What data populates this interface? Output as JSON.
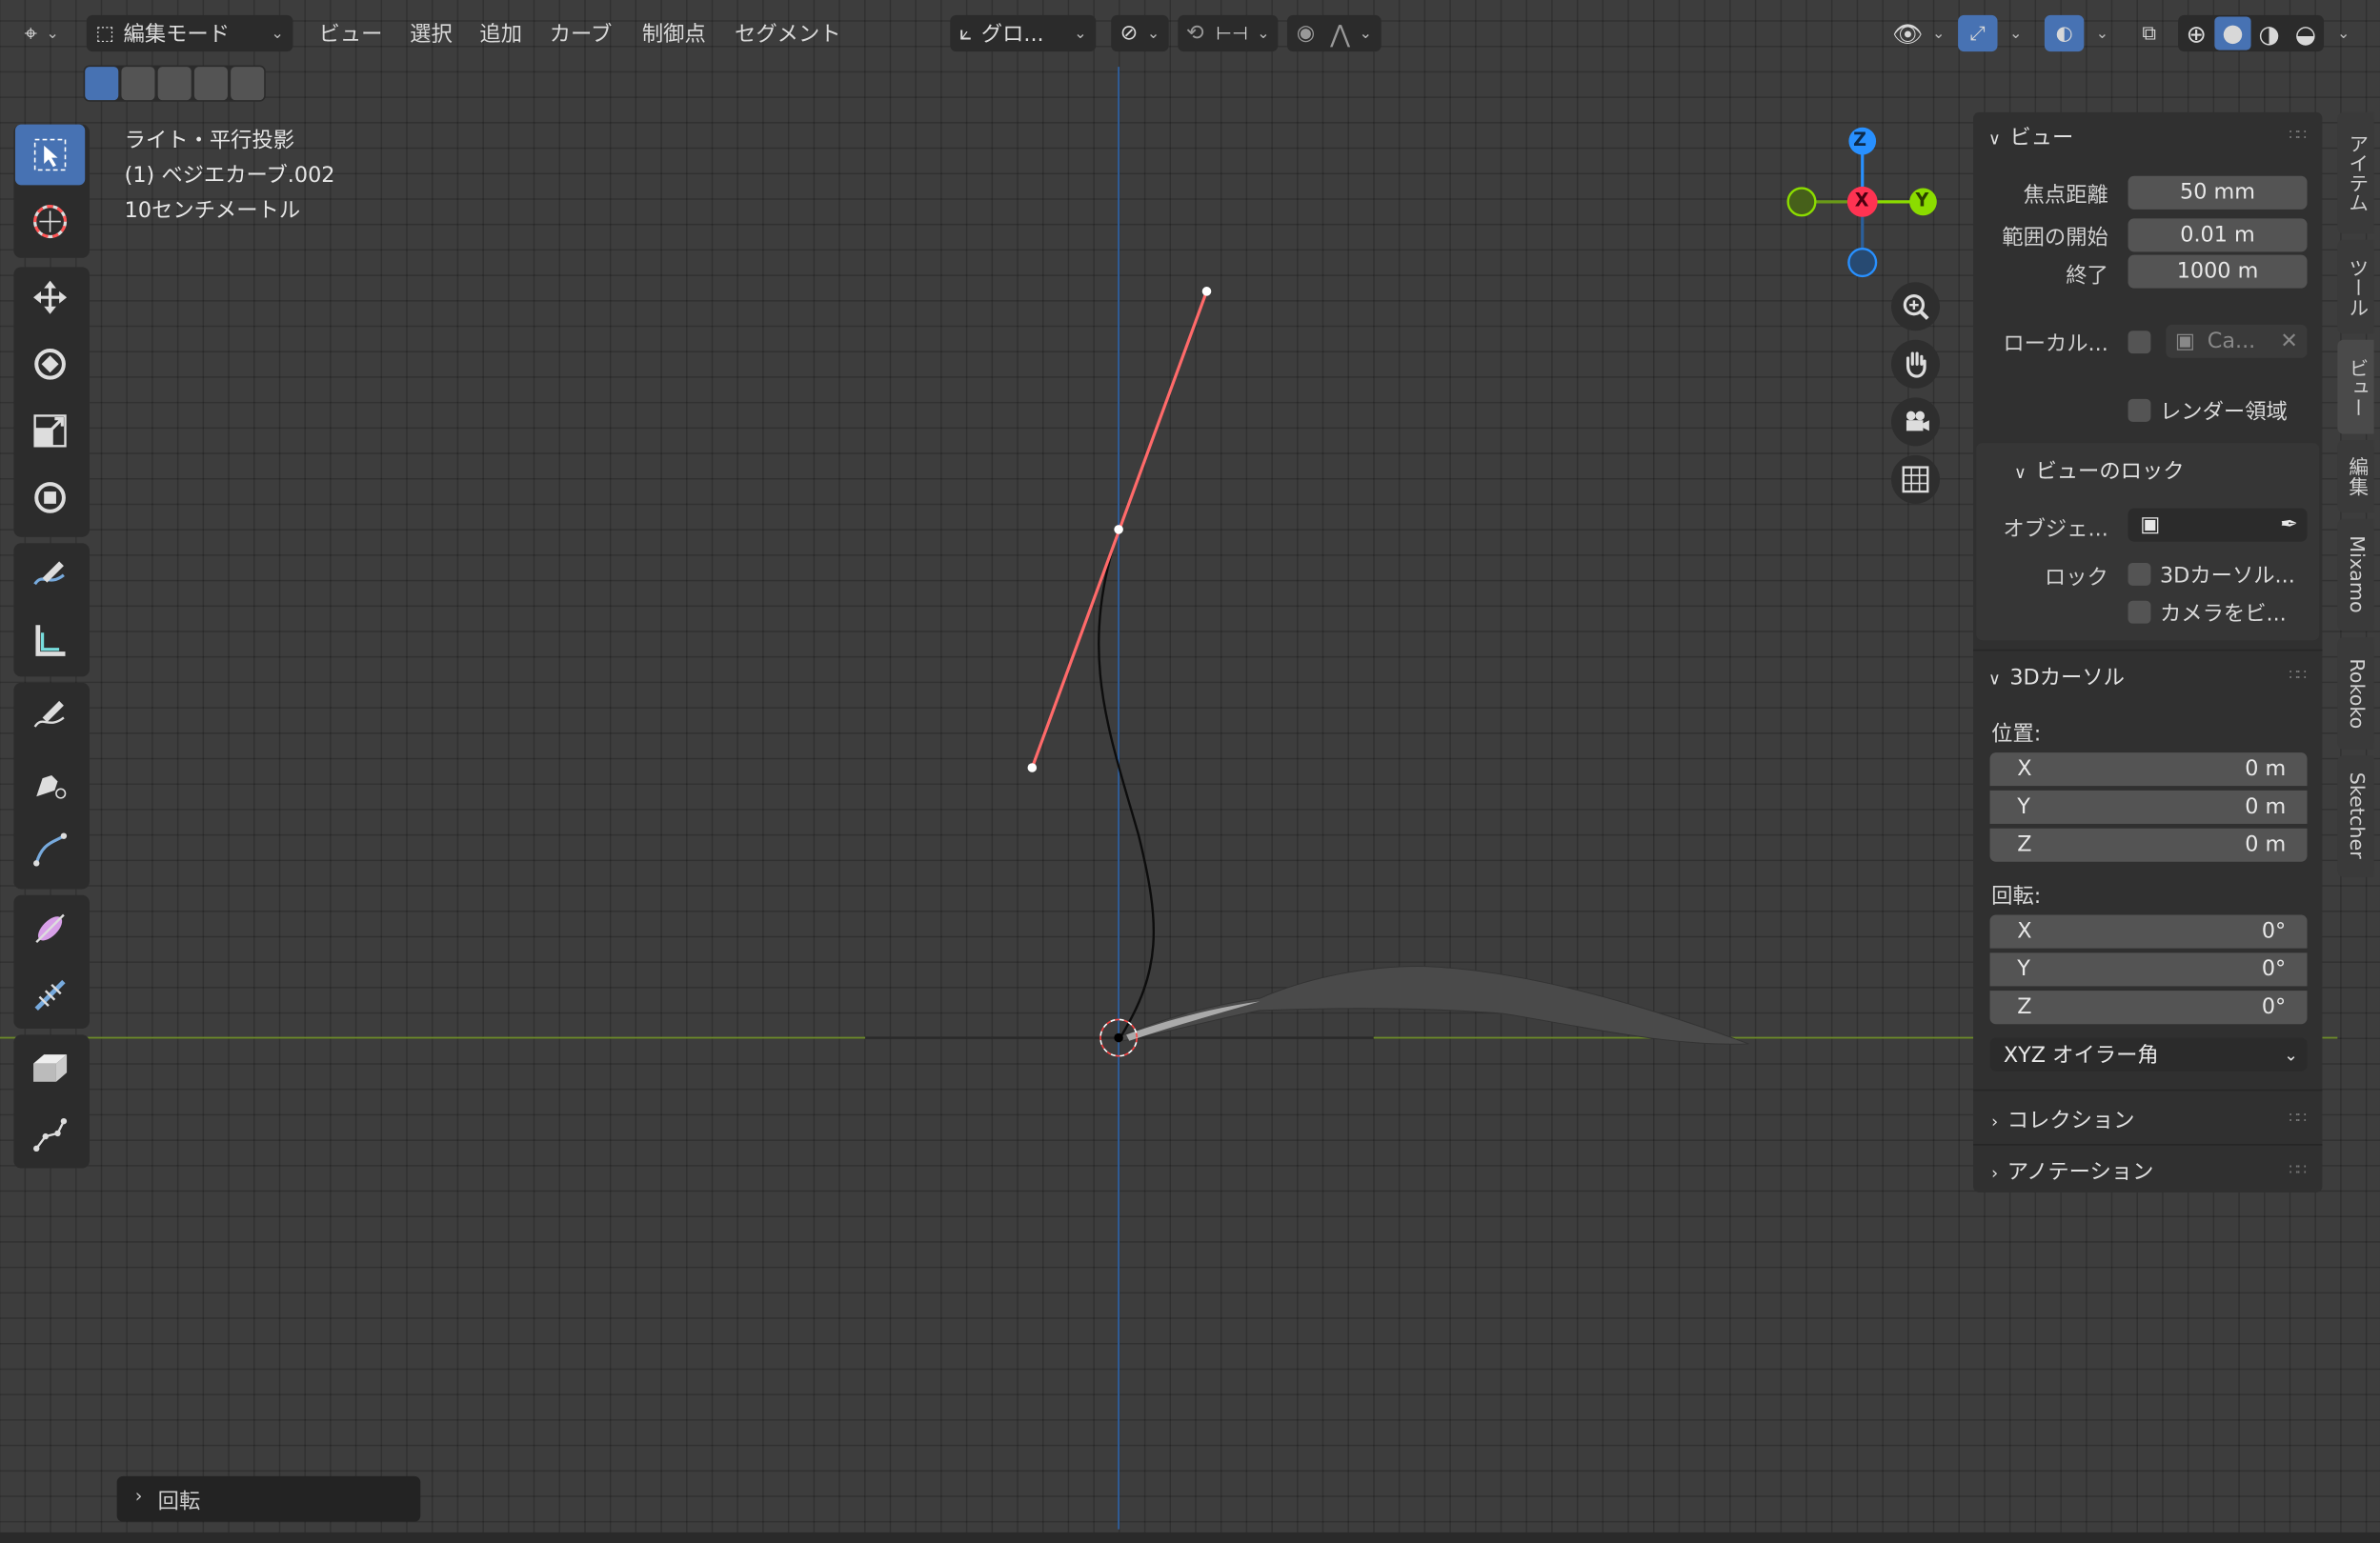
{
  "header": {
    "editor_type_icon": "view3d-icon",
    "mode_label": "編集モード",
    "menu": [
      "ビュー",
      "選択",
      "追加",
      "カーブ",
      "制御点",
      "セグメント"
    ],
    "orientation_label": "グロ...",
    "icons": [
      "transform-pivot-icon",
      "snap-icon",
      "snap-increment-icon",
      "proportional-edit-icon",
      "proportional-falloff-icon",
      "visibility-icon",
      "gizmo-icon",
      "overlay-icon",
      "xray-icon",
      "shading-wireframe-icon",
      "shading-solid-icon",
      "shading-material-icon",
      "shading-rendered-icon"
    ]
  },
  "select_modes": [
    "select-new-icon",
    "select-extend-icon",
    "select-subtract-icon",
    "select-invert-icon",
    "select-intersect-icon"
  ],
  "toolbar": {
    "tools": [
      "select-box-icon",
      "cursor-icon",
      "move-icon",
      "rotate-icon",
      "scale-icon",
      "transform-icon",
      "annotate-icon",
      "measure-icon",
      "draw-icon",
      "pen-icon",
      "curve-pen-icon",
      "radius-icon",
      "tilt-icon",
      "extrude-icon",
      "randomize-icon"
    ],
    "active": "select-box-icon"
  },
  "viewport": {
    "overlay": {
      "view_name": "ライト・平行投影",
      "object_name": "(1) ベジエカーブ.002",
      "grid_scale": "10センチメートル"
    },
    "gizmo": {
      "z": "Z",
      "x": "X",
      "y": "Y"
    },
    "colors": {
      "x_axis": "#ff3352",
      "y_axis": "#8bdc00",
      "z_axis": "#2890ff",
      "handle": "#ff6a6a",
      "curve": "#111111",
      "active_tool": "#4772b3"
    }
  },
  "npanel": {
    "view_section": {
      "title": "ビュー",
      "focal_label": "焦点距離",
      "focal_value": "50 mm",
      "clip_start_label": "範囲の開始",
      "clip_start_value": "0.01 m",
      "clip_end_label": "終了",
      "clip_end_value": "1000 m",
      "local_camera_label": "ローカル...",
      "local_camera_value": "Ca...",
      "render_region_label": "レンダー領域",
      "lock_title": "ビューのロック",
      "lock_object_label": "オブジェ...",
      "lock_label": "ロック",
      "lock_cursor_label": "3Dカーソル...",
      "lock_camera_label": "カメラをビ..."
    },
    "cursor_section": {
      "title": "3Dカーソル",
      "location_label": "位置:",
      "location": [
        {
          "axis": "X",
          "value": "0 m"
        },
        {
          "axis": "Y",
          "value": "0 m"
        },
        {
          "axis": "Z",
          "value": "0 m"
        }
      ],
      "rotation_label": "回転:",
      "rotation": [
        {
          "axis": "X",
          "value": "0°"
        },
        {
          "axis": "Y",
          "value": "0°"
        },
        {
          "axis": "Z",
          "value": "0°"
        }
      ],
      "rotation_mode": "XYZ オイラー角"
    },
    "collection_title": "コレクション",
    "annotation_title": "アノテーション"
  },
  "side_tabs": [
    "アイテム",
    "ツール",
    "ビュー",
    "編集",
    "Mixamo",
    "Rokoko",
    "Sketcher"
  ],
  "side_tab_active": "ビュー",
  "operator_panel": {
    "label": "回転"
  }
}
